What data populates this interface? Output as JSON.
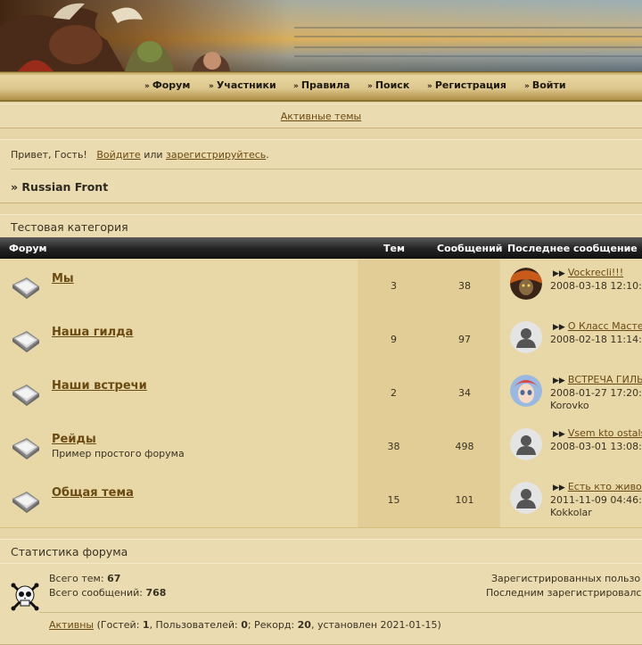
{
  "nav": {
    "items": [
      {
        "label": "Форум",
        "icon": "double-chevron-icon"
      },
      {
        "label": "Участники",
        "icon": "double-chevron-icon"
      },
      {
        "label": "Правила",
        "icon": "double-chevron-icon"
      },
      {
        "label": "Поиск",
        "icon": "double-chevron-icon"
      },
      {
        "label": "Регистрация",
        "icon": "double-chevron-icon"
      },
      {
        "label": "Войти",
        "icon": "double-chevron-icon"
      }
    ]
  },
  "active_topics": "Активные темы",
  "welcome": {
    "greeting": "Привет, Гость!",
    "login_link": "Войдите",
    "or": "или",
    "register_link": "зарегистрируйтесь",
    "period": "."
  },
  "breadcrumb": "» Russian Front",
  "category": "Тестовая категория",
  "table_headers": {
    "forum": "Форум",
    "topics": "Тем",
    "posts": "Сообщений",
    "last_post": "Последнее сообщение"
  },
  "forums": [
    {
      "name": "Мы",
      "desc": "",
      "topics": "3",
      "posts": "38",
      "last_title": "Vockrecli!!!",
      "last_date": "2008-03-18 12:10:",
      "last_user": "",
      "avatar": "warrior-avatar"
    },
    {
      "name": "Наша гилда",
      "desc": "",
      "topics": "9",
      "posts": "97",
      "last_title": "О Класс Масте",
      "last_date": "2008-02-18 11:14:",
      "last_user": "",
      "avatar": "default-avatar"
    },
    {
      "name": "Наши встречи",
      "desc": "",
      "topics": "2",
      "posts": "34",
      "last_title": "ВСТРЕЧА ГИЛЬ",
      "last_date": "2008-01-27 17:20:",
      "last_user": "Korovko",
      "avatar": "anime-avatar"
    },
    {
      "name": "Рейды",
      "desc": "Пример простого форума",
      "topics": "38",
      "posts": "498",
      "last_title": "Vsem kto ostals",
      "last_date": "2008-03-01 13:08:",
      "last_user": "",
      "avatar": "default-avatar"
    },
    {
      "name": "Общая тема",
      "desc": "",
      "topics": "15",
      "posts": "101",
      "last_title": "Есть кто живо",
      "last_date": "2011-11-09 04:46:",
      "last_user": "Kokkolar",
      "avatar": "default-avatar"
    }
  ],
  "stats": {
    "title": "Статистика форума",
    "topics_label": "Всего тем:",
    "topics_value": "67",
    "posts_label": "Всего сообщений:",
    "posts_value": "768",
    "registered_label": "Зарегистрированных пользо",
    "last_registered_label": "Последним зарегистрировалс",
    "active_link": "Активны",
    "online_open": "(Гостей:",
    "guests": "1",
    "users_label": ", Пользователей:",
    "users": "0",
    "record_label": "; Рекорд:",
    "record": "20",
    "set_label": ", установлен 2021-01-15)"
  },
  "colors": {
    "link": "#6b4a12",
    "panel": "#e6d4a4",
    "header": "#222222"
  }
}
